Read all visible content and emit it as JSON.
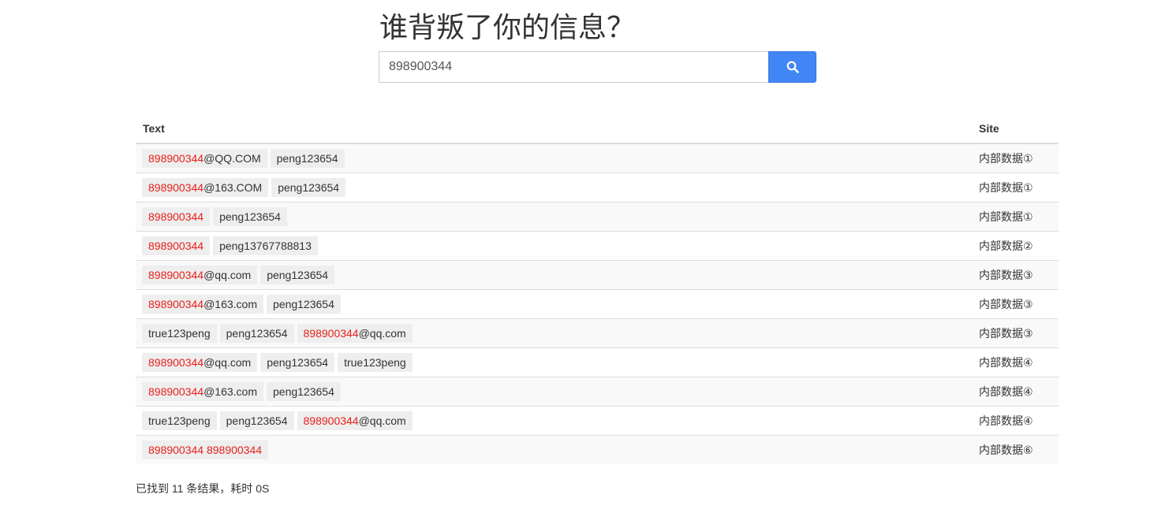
{
  "title": "谁背叛了你的信息？",
  "search": {
    "value": "898900344",
    "button_icon": "search-icon"
  },
  "table": {
    "headers": {
      "text": "Text",
      "site": "Site"
    },
    "rows": [
      {
        "tags": [
          {
            "hl": "898900344",
            "rest": "@QQ.COM"
          },
          {
            "hl": "",
            "rest": "peng123654"
          }
        ],
        "site": "内部数据①"
      },
      {
        "tags": [
          {
            "hl": "898900344",
            "rest": "@163.COM"
          },
          {
            "hl": "",
            "rest": "peng123654"
          }
        ],
        "site": "内部数据①"
      },
      {
        "tags": [
          {
            "hl": "898900344",
            "rest": ""
          },
          {
            "hl": "",
            "rest": "peng123654"
          }
        ],
        "site": "内部数据①"
      },
      {
        "tags": [
          {
            "hl": "898900344",
            "rest": ""
          },
          {
            "hl": "",
            "rest": "peng13767788813"
          }
        ],
        "site": "内部数据②"
      },
      {
        "tags": [
          {
            "hl": "898900344",
            "rest": "@qq.com"
          },
          {
            "hl": "",
            "rest": "peng123654"
          }
        ],
        "site": "内部数据③"
      },
      {
        "tags": [
          {
            "hl": "898900344",
            "rest": "@163.com"
          },
          {
            "hl": "",
            "rest": "peng123654"
          }
        ],
        "site": "内部数据③"
      },
      {
        "tags": [
          {
            "hl": "",
            "rest": "true123peng"
          },
          {
            "hl": "",
            "rest": "peng123654"
          },
          {
            "hl": "898900344",
            "rest": "@qq.com"
          }
        ],
        "site": "内部数据③"
      },
      {
        "tags": [
          {
            "hl": "898900344",
            "rest": "@qq.com"
          },
          {
            "hl": "",
            "rest": "peng123654"
          },
          {
            "hl": "",
            "rest": "true123peng"
          }
        ],
        "site": "内部数据④"
      },
      {
        "tags": [
          {
            "hl": "898900344",
            "rest": "@163.com"
          },
          {
            "hl": "",
            "rest": "peng123654"
          }
        ],
        "site": "内部数据④"
      },
      {
        "tags": [
          {
            "hl": "",
            "rest": "true123peng"
          },
          {
            "hl": "",
            "rest": "peng123654"
          },
          {
            "hl": "898900344",
            "rest": "@qq.com"
          }
        ],
        "site": "内部数据④"
      },
      {
        "tags": [
          {
            "hl": "898900344 898900344",
            "rest": ""
          }
        ],
        "site": "内部数据⑥"
      }
    ]
  },
  "footer": "已找到 11 条结果，耗时 0S",
  "colors": {
    "accent": "#4285f4",
    "highlight": "#e8201b",
    "tag_bg": "#eeeeee"
  }
}
